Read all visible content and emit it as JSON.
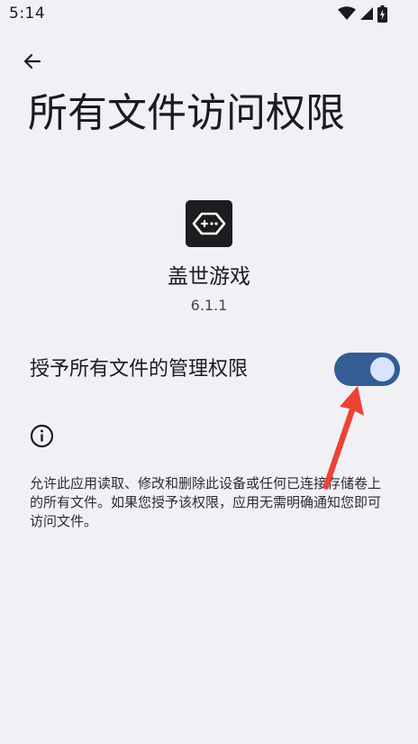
{
  "status_bar": {
    "time": "5:14",
    "icons": [
      "wifi-icon",
      "signal-icon",
      "battery-charging-icon"
    ]
  },
  "header": {
    "back_icon": "arrow-back-icon",
    "title": "所有文件访问权限"
  },
  "app": {
    "icon": "gamepad-icon",
    "name": "盖世游戏",
    "version": "6.1.1"
  },
  "permission": {
    "label": "授予所有文件的管理权限",
    "enabled": true
  },
  "info": {
    "icon": "info-icon",
    "description": "允许此应用读取、修改和删除此设备或任何已连接存储卷上的所有文件。如果您授予该权限，应用无需明确通知您即可访问文件。"
  },
  "colors": {
    "background": "#f1f0f5",
    "toggle_track": "#335d93",
    "toggle_thumb": "#d7e3ff",
    "annotation_arrow": "#ee4235"
  }
}
